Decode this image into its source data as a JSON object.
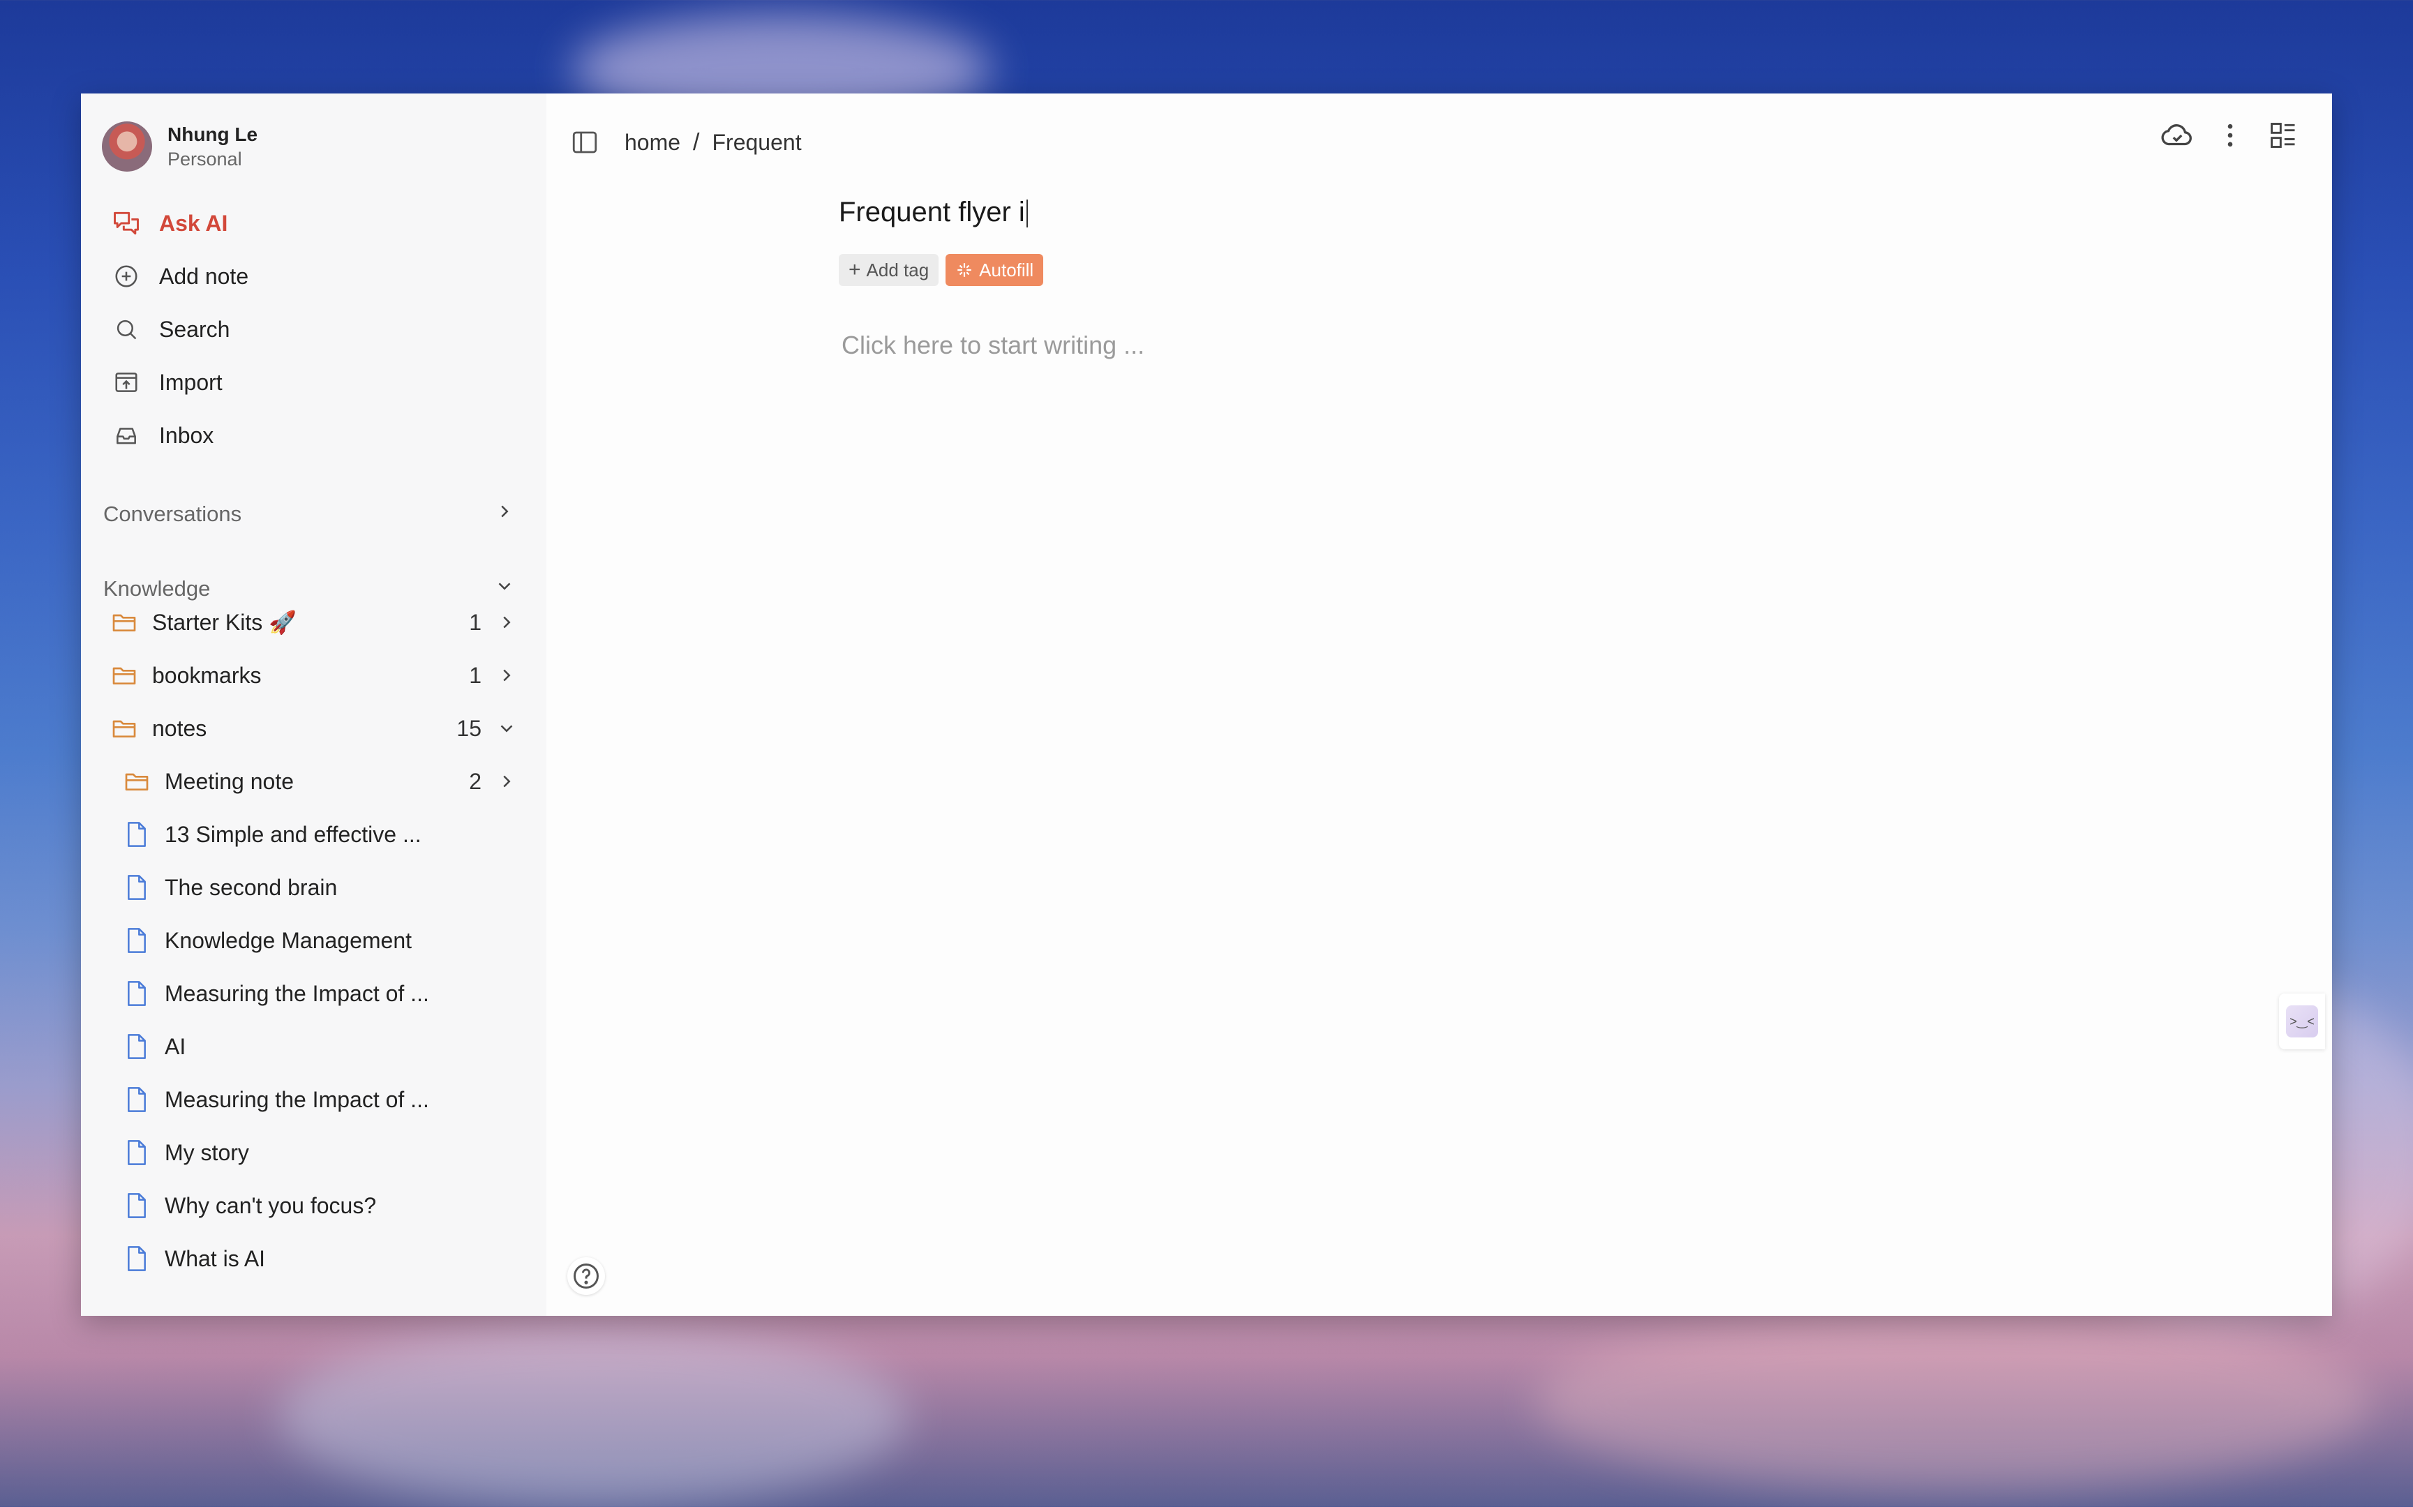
{
  "profile": {
    "name": "Nhung Le",
    "workspace": "Personal"
  },
  "nav": {
    "ask_ai": "Ask AI",
    "add_note": "Add note",
    "search": "Search",
    "import": "Import",
    "inbox": "Inbox"
  },
  "sections": {
    "conversations": "Conversations",
    "knowledge": "Knowledge"
  },
  "knowledge": {
    "folders": [
      {
        "label": "Starter Kits 🚀",
        "count": "1"
      },
      {
        "label": "bookmarks",
        "count": "1"
      },
      {
        "label": "notes",
        "count": "15"
      }
    ],
    "subfolder": {
      "label": "Meeting note",
      "count": "2"
    },
    "notes": [
      "13 Simple and effective ...",
      "The second brain",
      "Knowledge Management",
      "Measuring the Impact of ...",
      "AI",
      "Measuring the Impact of ...",
      "My story",
      "Why can't you focus?",
      "What is AI"
    ]
  },
  "breadcrumb": {
    "root": "home",
    "separator": "/",
    "current": "Frequent"
  },
  "editor": {
    "title": "Frequent flyer i",
    "add_tag": "Add tag",
    "autofill": "Autofill",
    "placeholder": "Click here to start writing ..."
  },
  "colors": {
    "accent_red": "#d2483a",
    "autofill_orange": "#ef8a5f",
    "folder_orange": "#d98a3d",
    "doc_blue": "#4a7bd8"
  }
}
